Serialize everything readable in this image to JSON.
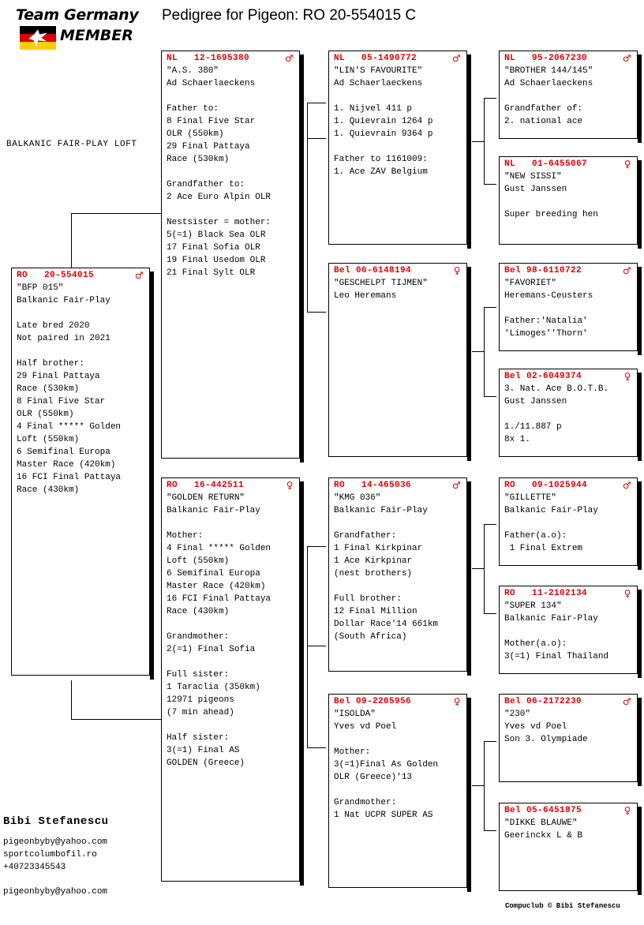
{
  "title": "Pedigree for Pigeon: RO  20-554015 C",
  "logo": {
    "line1": "Team Germany",
    "line2": "MEMBER",
    "flag_colors": [
      "#000000",
      "#dd0000",
      "#ffce00"
    ],
    "dove_icon": "dove-icon"
  },
  "loft_caption": "BALKANIC FAIR-PLAY LOFT",
  "accent_color": "#dd0000",
  "male_symbol": "♂",
  "female_symbol": "♀",
  "subject": {
    "ring": "RO   20-554015",
    "sex": "male",
    "body": "\"BFP 015\"\nBalkanic Fair-Play\n\nLate bred 2020\nNot paired in 2021\n\nHalf brother:\n29 Final Pattaya\nRace (530km)\n8 Final Five Star\nOLR (550km)\n4 Final ***** Golden\nLoft (550km)\n6 Semifinal Europa\nMaster Race (420km)\n16 FCI Final Pattaya\nRace (430km)"
  },
  "generation2": [
    {
      "ring": "NL   12-1695380",
      "sex": "male",
      "body": "\"A.S. 380\"\nAd Schaerlaeckens\n\nFather to:\n8 Final Five Star\nOLR (550km)\n29 Final Pattaya\nRace (530km)\n\nGrandfather to:\n2 Ace Euro Alpin OLR\n\nNestsister = mother:\n5(=1) Black Sea OLR\n17 Final Sofia OLR\n19 Final Usedom OLR\n21 Final Sylt OLR"
    },
    {
      "ring": "RO   16-442511",
      "sex": "female",
      "body": "\"GOLDEN RETURN\"\nBalkanic Fair-Play\n\nMother:\n4 Final ***** Golden\nLoft (550km)\n6 Semifinal Europa\nMaster Race (420km)\n16 FCI Final Pattaya\nRace (430km)\n\nGrandmother:\n2(=1) Final Sofia\n\nFull sister:\n1 Taraclia (350km)\n12971 pigeons\n(7 min ahead)\n\nHalf sister:\n3(=1) Final AS\nGOLDEN (Greece)"
    }
  ],
  "generation3": [
    {
      "ring": "NL   05-1490772",
      "sex": "male",
      "body": "\"LIN'S FAVOURITE\"\nAd Schaerlaeckens\n\n1. Nijvel 411 p\n1. Quievrain 1264 p\n1. Quievrain 9364 p\n\nFather to 1161009:\n1. Ace ZAV Belgium"
    },
    {
      "ring": "Bel 06-6148194",
      "sex": "female",
      "body": "\"GESCHELPT TIJMEN\"\nLeo Heremans"
    },
    {
      "ring": "RO   14-465036",
      "sex": "male",
      "body": "\"KMG 036\"\nBalkanic Fair-Play\n\nGrandfather:\n1 Final Kirkpinar\n1 Ace Kirkpinar\n(nest brothers)\n\nFull brother:\n12 Final Million\nDollar Race'14 661km\n(South Africa)"
    },
    {
      "ring": "Bel 09-2205956",
      "sex": "female",
      "body": "\"ISOLDA\"\nYves vd Poel\n\nMother:\n3(=1)Final As Golden\nOLR (Greece)'13\n\nGrandmother:\n1 Nat UCPR SUPER AS"
    }
  ],
  "generation4": [
    {
      "ring": "NL   95-2067230",
      "sex": "male",
      "body": "\"BROTHER 144/145\"\nAd Schaerlaeckens\n\nGrandfather of:\n2. national ace"
    },
    {
      "ring": "NL   01-6455067",
      "sex": "female",
      "body": "\"NEW SISSI\"\nGust Janssen\n\nSuper breeding hen"
    },
    {
      "ring": "Bel 98-6110722",
      "sex": "male",
      "body": "\"FAVORIET\"\nHeremans-Ceusters\n\nFather:'Natalia'\n'Limoges''Thorn'"
    },
    {
      "ring": "Bel 02-6049374",
      "sex": "female",
      "body": "3. Nat. Ace B.O.T.B.\nGust Janssen\n\n1./11.887 p\n8x 1."
    },
    {
      "ring": "RO   09-1025944",
      "sex": "male",
      "body": "\"GILLETTE\"\nBalkanic Fair-Play\n\nFather(a.o):\n 1 Final Extrem"
    },
    {
      "ring": "RO   11-2102134",
      "sex": "female",
      "body": "\"SUPER 134\"\nBalkanic Fair-Play\n\nMother(a.o):\n3(=1) Final Thailand"
    },
    {
      "ring": "Bel 06-2172230",
      "sex": "male",
      "body": "\"230\"\nYves vd Poel\nSon 3. Olympiade"
    },
    {
      "ring": "Bel 05-6451875",
      "sex": "female",
      "body": "\"DIKKE BLAUWE\"\nGeerinckx L & B"
    }
  ],
  "footer": {
    "name": "Bibi Stefanescu",
    "contact": "pigeonbyby@yahoo.com\nsportcolumbofil.ro\n+40723345543",
    "email2": "pigeonbyby@yahoo.com",
    "copyright": "Compuclub © Bibi Stefanescu"
  }
}
